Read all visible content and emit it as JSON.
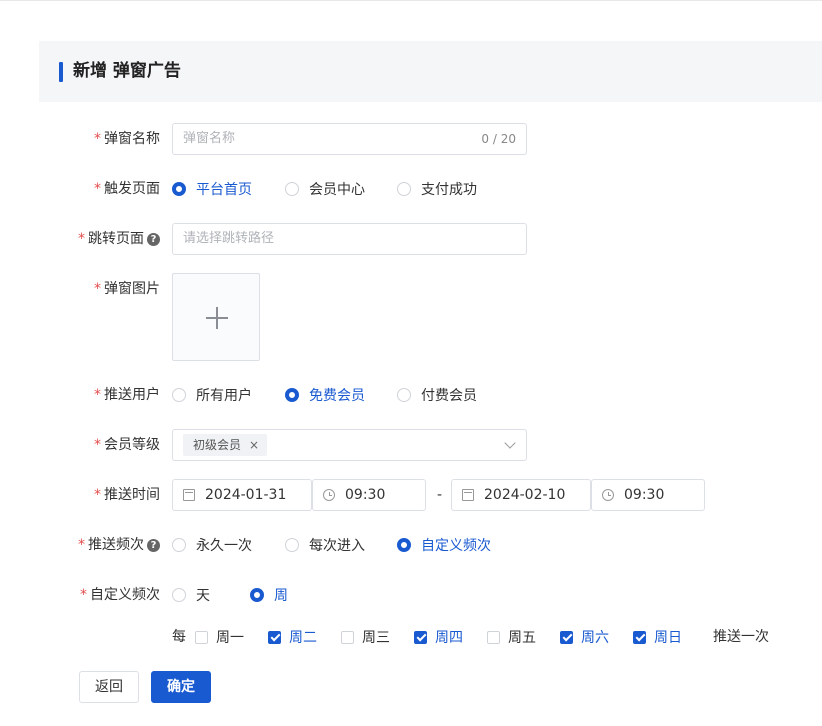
{
  "page": {
    "title": "新增 弹窗广告"
  },
  "form": {
    "popup_name": {
      "label": "弹窗名称",
      "placeholder": "弹窗名称",
      "counter": "0 / 20"
    },
    "trigger_page": {
      "label": "触发页面",
      "options": [
        "平台首页",
        "会员中心",
        "支付成功"
      ],
      "selected": "平台首页"
    },
    "redirect_page": {
      "label": "跳转页面",
      "help_icon": "question-circle-icon",
      "placeholder": "请选择跳转路径"
    },
    "popup_image": {
      "label": "弹窗图片",
      "icon": "plus-icon"
    },
    "push_users": {
      "label": "推送用户",
      "options": [
        "所有用户",
        "免费会员",
        "付费会员"
      ],
      "selected": "免费会员"
    },
    "member_level": {
      "label": "会员等级",
      "tags": [
        "初级会员"
      ],
      "tag_close": "×",
      "icon": "chevron-down-icon"
    },
    "push_time": {
      "label": "推送时间",
      "start_date": "2024-01-31",
      "start_time": "09:30",
      "separator": "-",
      "end_date": "2024-02-10",
      "end_time": "09:30"
    },
    "push_frequency": {
      "label": "推送频次",
      "help_icon": "question-circle-icon",
      "options": [
        "永久一次",
        "每次进入",
        "自定义频次"
      ],
      "selected": "自定义频次"
    },
    "custom_frequency": {
      "label": "自定义频次",
      "options": [
        "天",
        "周"
      ],
      "selected": "周"
    },
    "weekdays": {
      "prefix": "每",
      "days": [
        {
          "label": "周一",
          "checked": false
        },
        {
          "label": "周二",
          "checked": true
        },
        {
          "label": "周三",
          "checked": false
        },
        {
          "label": "周四",
          "checked": true
        },
        {
          "label": "周五",
          "checked": false
        },
        {
          "label": "周六",
          "checked": true
        },
        {
          "label": "周日",
          "checked": true
        }
      ],
      "suffix": "推送一次"
    }
  },
  "actions": {
    "back_label": "返回",
    "confirm_label": "确定"
  },
  "colors": {
    "primary": "#1a5ad1",
    "required": "#e34d4d"
  }
}
